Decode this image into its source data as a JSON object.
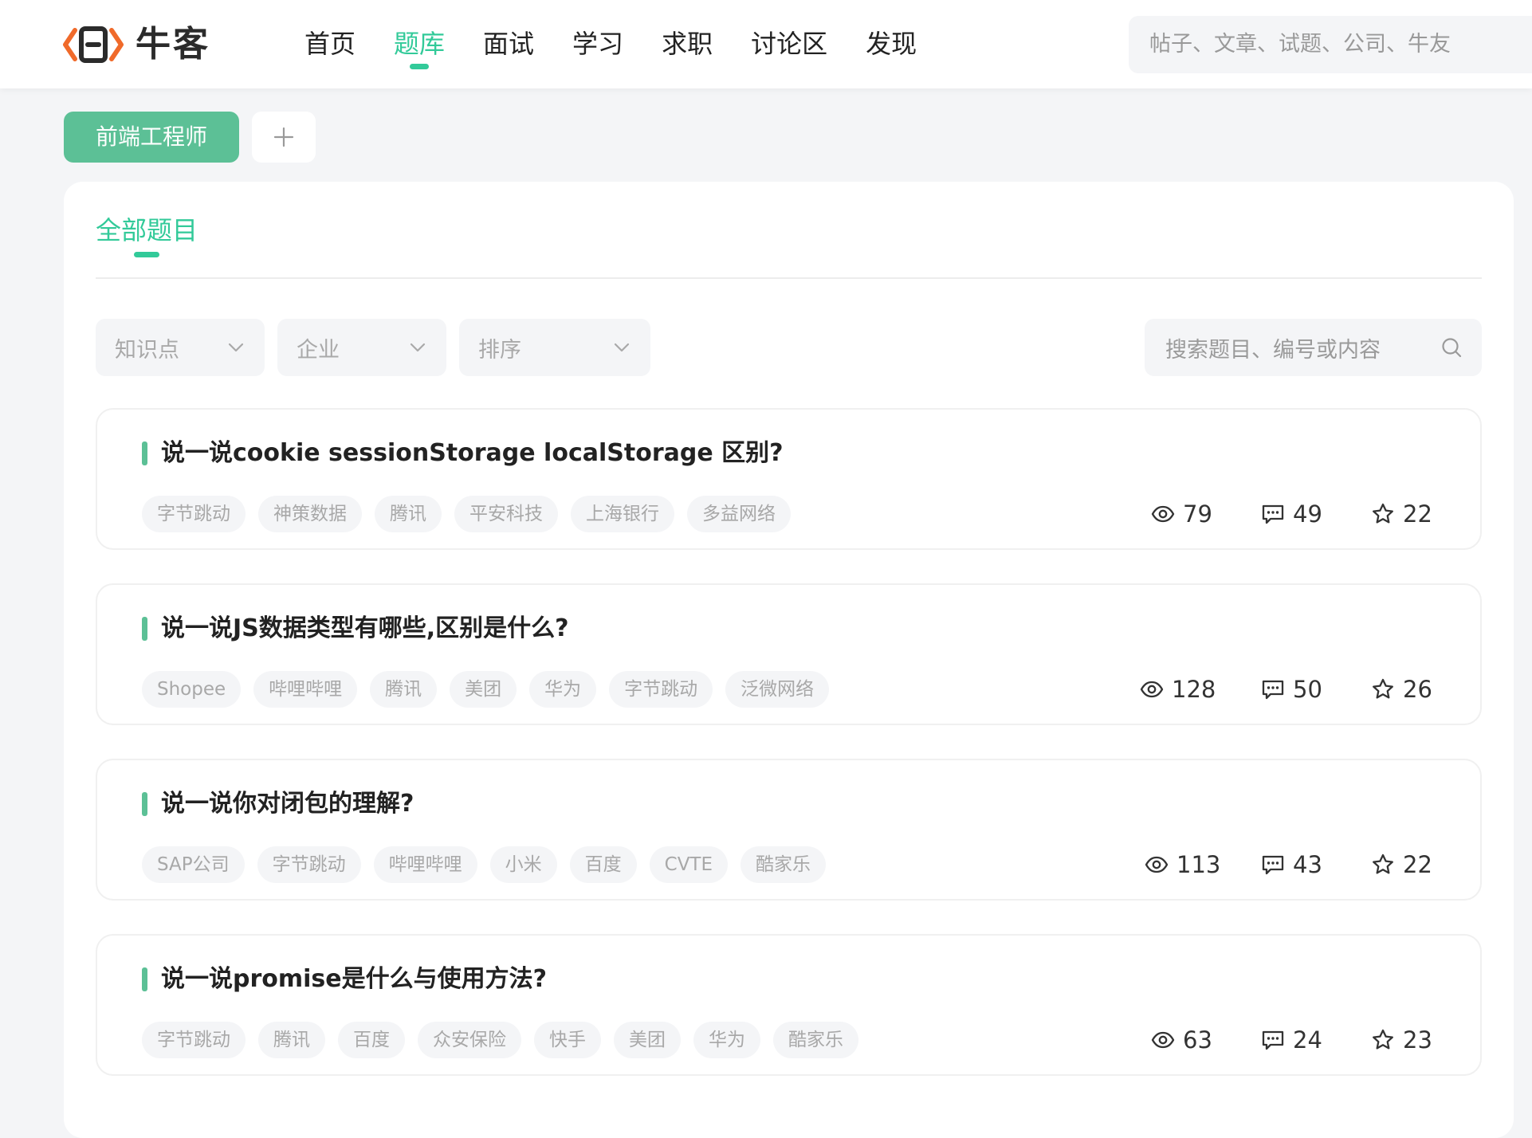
{
  "header": {
    "logo_text": "牛客",
    "nav": [
      {
        "label": "首页",
        "active": false
      },
      {
        "label": "题库",
        "active": true
      },
      {
        "label": "面试",
        "active": false
      },
      {
        "label": "学习",
        "active": false
      },
      {
        "label": "求职",
        "active": false
      },
      {
        "label": "讨论区",
        "active": false
      },
      {
        "label": "发现",
        "active": false
      }
    ],
    "search_placeholder": "帖子、文章、试题、公司、牛友"
  },
  "job_tags": {
    "current": "前端工程师",
    "add_label": "+"
  },
  "section": {
    "tab_label": "全部题目"
  },
  "filters": {
    "knowledge": "知识点",
    "company": "企业",
    "sort": "排序",
    "search_placeholder": "搜索题目、编号或内容"
  },
  "colors": {
    "accent": "#32ca99",
    "tag_green": "#5cc096",
    "tag_bg": "#f4f5f7",
    "muted_text": "#a8a8a8"
  },
  "questions": [
    {
      "title": "说一说cookie sessionStorage localStorage 区别?",
      "tags": [
        "字节跳动",
        "神策数据",
        "腾讯",
        "平安科技",
        "上海银行",
        "多益网络"
      ],
      "views": "79",
      "comments": "49",
      "stars": "22"
    },
    {
      "title": "说一说JS数据类型有哪些,区别是什么?",
      "tags": [
        "Shopee",
        "哔哩哔哩",
        "腾讯",
        "美团",
        "华为",
        "字节跳动",
        "泛微网络"
      ],
      "views": "128",
      "comments": "50",
      "stars": "26"
    },
    {
      "title": "说一说你对闭包的理解?",
      "tags": [
        "SAP公司",
        "字节跳动",
        "哔哩哔哩",
        "小米",
        "百度",
        "CVTE",
        "酷家乐"
      ],
      "views": "113",
      "comments": "43",
      "stars": "22"
    },
    {
      "title": "说一说promise是什么与使用方法?",
      "tags": [
        "字节跳动",
        "腾讯",
        "百度",
        "众安保险",
        "快手",
        "美团",
        "华为",
        "酷家乐"
      ],
      "views": "63",
      "comments": "24",
      "stars": "23"
    }
  ]
}
